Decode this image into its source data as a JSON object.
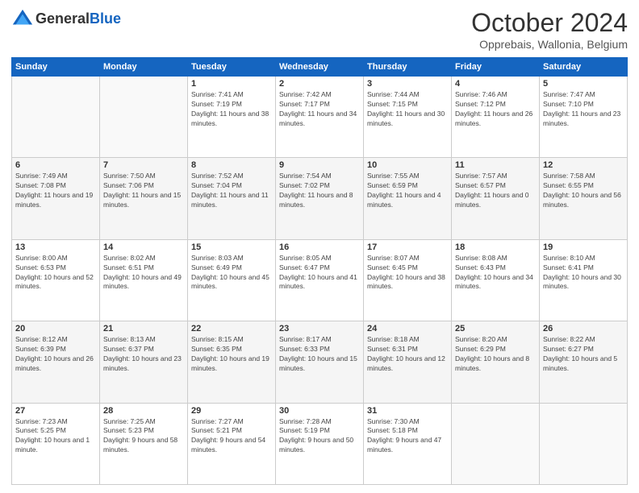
{
  "header": {
    "logo_general": "General",
    "logo_blue": "Blue",
    "month": "October 2024",
    "location": "Opprebais, Wallonia, Belgium"
  },
  "days_of_week": [
    "Sunday",
    "Monday",
    "Tuesday",
    "Wednesday",
    "Thursday",
    "Friday",
    "Saturday"
  ],
  "weeks": [
    [
      {
        "day": "",
        "sunrise": "",
        "sunset": "",
        "daylight": ""
      },
      {
        "day": "",
        "sunrise": "",
        "sunset": "",
        "daylight": ""
      },
      {
        "day": "1",
        "sunrise": "Sunrise: 7:41 AM",
        "sunset": "Sunset: 7:19 PM",
        "daylight": "Daylight: 11 hours and 38 minutes."
      },
      {
        "day": "2",
        "sunrise": "Sunrise: 7:42 AM",
        "sunset": "Sunset: 7:17 PM",
        "daylight": "Daylight: 11 hours and 34 minutes."
      },
      {
        "day": "3",
        "sunrise": "Sunrise: 7:44 AM",
        "sunset": "Sunset: 7:15 PM",
        "daylight": "Daylight: 11 hours and 30 minutes."
      },
      {
        "day": "4",
        "sunrise": "Sunrise: 7:46 AM",
        "sunset": "Sunset: 7:12 PM",
        "daylight": "Daylight: 11 hours and 26 minutes."
      },
      {
        "day": "5",
        "sunrise": "Sunrise: 7:47 AM",
        "sunset": "Sunset: 7:10 PM",
        "daylight": "Daylight: 11 hours and 23 minutes."
      }
    ],
    [
      {
        "day": "6",
        "sunrise": "Sunrise: 7:49 AM",
        "sunset": "Sunset: 7:08 PM",
        "daylight": "Daylight: 11 hours and 19 minutes."
      },
      {
        "day": "7",
        "sunrise": "Sunrise: 7:50 AM",
        "sunset": "Sunset: 7:06 PM",
        "daylight": "Daylight: 11 hours and 15 minutes."
      },
      {
        "day": "8",
        "sunrise": "Sunrise: 7:52 AM",
        "sunset": "Sunset: 7:04 PM",
        "daylight": "Daylight: 11 hours and 11 minutes."
      },
      {
        "day": "9",
        "sunrise": "Sunrise: 7:54 AM",
        "sunset": "Sunset: 7:02 PM",
        "daylight": "Daylight: 11 hours and 8 minutes."
      },
      {
        "day": "10",
        "sunrise": "Sunrise: 7:55 AM",
        "sunset": "Sunset: 6:59 PM",
        "daylight": "Daylight: 11 hours and 4 minutes."
      },
      {
        "day": "11",
        "sunrise": "Sunrise: 7:57 AM",
        "sunset": "Sunset: 6:57 PM",
        "daylight": "Daylight: 11 hours and 0 minutes."
      },
      {
        "day": "12",
        "sunrise": "Sunrise: 7:58 AM",
        "sunset": "Sunset: 6:55 PM",
        "daylight": "Daylight: 10 hours and 56 minutes."
      }
    ],
    [
      {
        "day": "13",
        "sunrise": "Sunrise: 8:00 AM",
        "sunset": "Sunset: 6:53 PM",
        "daylight": "Daylight: 10 hours and 52 minutes."
      },
      {
        "day": "14",
        "sunrise": "Sunrise: 8:02 AM",
        "sunset": "Sunset: 6:51 PM",
        "daylight": "Daylight: 10 hours and 49 minutes."
      },
      {
        "day": "15",
        "sunrise": "Sunrise: 8:03 AM",
        "sunset": "Sunset: 6:49 PM",
        "daylight": "Daylight: 10 hours and 45 minutes."
      },
      {
        "day": "16",
        "sunrise": "Sunrise: 8:05 AM",
        "sunset": "Sunset: 6:47 PM",
        "daylight": "Daylight: 10 hours and 41 minutes."
      },
      {
        "day": "17",
        "sunrise": "Sunrise: 8:07 AM",
        "sunset": "Sunset: 6:45 PM",
        "daylight": "Daylight: 10 hours and 38 minutes."
      },
      {
        "day": "18",
        "sunrise": "Sunrise: 8:08 AM",
        "sunset": "Sunset: 6:43 PM",
        "daylight": "Daylight: 10 hours and 34 minutes."
      },
      {
        "day": "19",
        "sunrise": "Sunrise: 8:10 AM",
        "sunset": "Sunset: 6:41 PM",
        "daylight": "Daylight: 10 hours and 30 minutes."
      }
    ],
    [
      {
        "day": "20",
        "sunrise": "Sunrise: 8:12 AM",
        "sunset": "Sunset: 6:39 PM",
        "daylight": "Daylight: 10 hours and 26 minutes."
      },
      {
        "day": "21",
        "sunrise": "Sunrise: 8:13 AM",
        "sunset": "Sunset: 6:37 PM",
        "daylight": "Daylight: 10 hours and 23 minutes."
      },
      {
        "day": "22",
        "sunrise": "Sunrise: 8:15 AM",
        "sunset": "Sunset: 6:35 PM",
        "daylight": "Daylight: 10 hours and 19 minutes."
      },
      {
        "day": "23",
        "sunrise": "Sunrise: 8:17 AM",
        "sunset": "Sunset: 6:33 PM",
        "daylight": "Daylight: 10 hours and 15 minutes."
      },
      {
        "day": "24",
        "sunrise": "Sunrise: 8:18 AM",
        "sunset": "Sunset: 6:31 PM",
        "daylight": "Daylight: 10 hours and 12 minutes."
      },
      {
        "day": "25",
        "sunrise": "Sunrise: 8:20 AM",
        "sunset": "Sunset: 6:29 PM",
        "daylight": "Daylight: 10 hours and 8 minutes."
      },
      {
        "day": "26",
        "sunrise": "Sunrise: 8:22 AM",
        "sunset": "Sunset: 6:27 PM",
        "daylight": "Daylight: 10 hours and 5 minutes."
      }
    ],
    [
      {
        "day": "27",
        "sunrise": "Sunrise: 7:23 AM",
        "sunset": "Sunset: 5:25 PM",
        "daylight": "Daylight: 10 hours and 1 minute."
      },
      {
        "day": "28",
        "sunrise": "Sunrise: 7:25 AM",
        "sunset": "Sunset: 5:23 PM",
        "daylight": "Daylight: 9 hours and 58 minutes."
      },
      {
        "day": "29",
        "sunrise": "Sunrise: 7:27 AM",
        "sunset": "Sunset: 5:21 PM",
        "daylight": "Daylight: 9 hours and 54 minutes."
      },
      {
        "day": "30",
        "sunrise": "Sunrise: 7:28 AM",
        "sunset": "Sunset: 5:19 PM",
        "daylight": "Daylight: 9 hours and 50 minutes."
      },
      {
        "day": "31",
        "sunrise": "Sunrise: 7:30 AM",
        "sunset": "Sunset: 5:18 PM",
        "daylight": "Daylight: 9 hours and 47 minutes."
      },
      {
        "day": "",
        "sunrise": "",
        "sunset": "",
        "daylight": ""
      },
      {
        "day": "",
        "sunrise": "",
        "sunset": "",
        "daylight": ""
      }
    ]
  ]
}
